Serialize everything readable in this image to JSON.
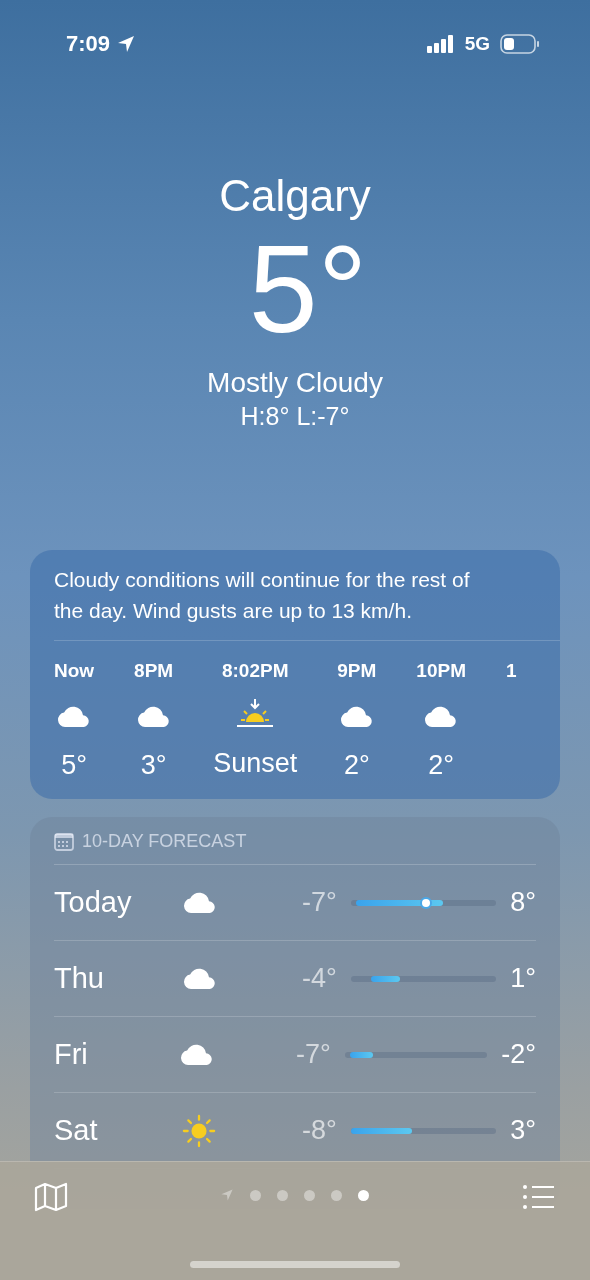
{
  "status_bar": {
    "time": "7:09",
    "network": "5G"
  },
  "header": {
    "city": "Calgary",
    "temperature": "5°",
    "condition": "Mostly Cloudy",
    "high_low": "H:8°  L:-7°"
  },
  "hourly": {
    "summary": "Cloudy conditions will continue for the rest of the day. Wind gusts are up to 13 km/h.",
    "items": [
      {
        "kind": "cloud",
        "time": "Now",
        "value": "5°"
      },
      {
        "kind": "cloud",
        "time": "8PM",
        "value": "3°"
      },
      {
        "kind": "sunset",
        "time": "8:02PM",
        "value": "Sunset"
      },
      {
        "kind": "cloud",
        "time": "9PM",
        "value": "2°"
      },
      {
        "kind": "cloud",
        "time": "10PM",
        "value": "2°"
      },
      {
        "kind": "cut",
        "time": "1"
      }
    ]
  },
  "forecast": {
    "title": "10-DAY FORECAST",
    "days": [
      {
        "day": "Today",
        "kind": "cloud",
        "low": "-7°",
        "high": "8°",
        "level": 0.6,
        "now_marker": true
      },
      {
        "day": "Thu",
        "kind": "cloud",
        "low": "-4°",
        "high": "1°",
        "level": 0.2,
        "now_marker": false
      },
      {
        "day": "Fri",
        "kind": "cloud",
        "low": "-7°",
        "high": "-2°",
        "level": 0.16,
        "now_marker": false
      },
      {
        "day": "Sat",
        "kind": "sun",
        "low": "-8°",
        "high": "3°",
        "level": 0.42,
        "now_marker": false
      }
    ]
  },
  "pages": [
    {
      "kind": "location",
      "selected": false
    },
    {
      "kind": "dot",
      "selected": false
    },
    {
      "kind": "dot",
      "selected": false
    },
    {
      "kind": "dot",
      "selected": false
    },
    {
      "kind": "dot",
      "selected": false
    },
    {
      "kind": "dot",
      "selected": true
    }
  ]
}
